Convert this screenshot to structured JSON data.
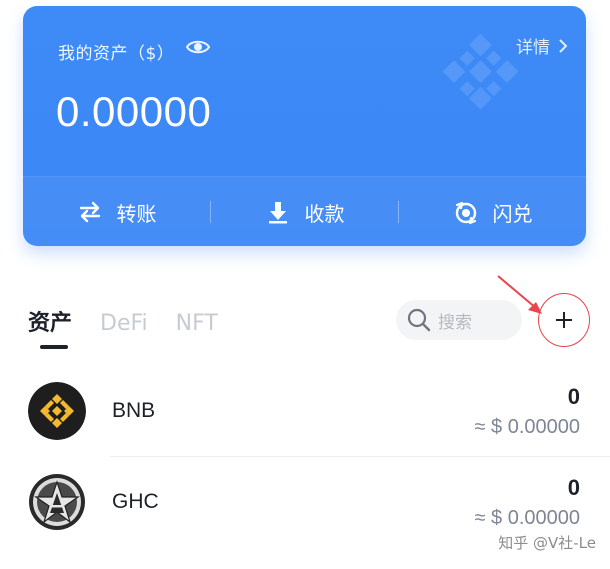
{
  "card": {
    "asset_label": "我的资产（$）",
    "details_label": "详情",
    "balance": "0.00000",
    "actions": [
      {
        "label": "转账",
        "icon": "transfer-icon"
      },
      {
        "label": "收款",
        "icon": "receive-icon"
      },
      {
        "label": "闪兑",
        "icon": "swap-icon"
      }
    ]
  },
  "tabs": [
    {
      "label": "资产",
      "active": true
    },
    {
      "label": "DeFi",
      "active": false
    },
    {
      "label": "NFT",
      "active": false
    }
  ],
  "search": {
    "placeholder": "搜索"
  },
  "tokens": [
    {
      "symbol": "BNB",
      "amount": "0",
      "fiat": "≈ $ 0.00000"
    },
    {
      "symbol": "GHC",
      "amount": "0",
      "fiat": "≈ $ 0.00000"
    }
  ],
  "watermark": "知乎 @V社-Le",
  "colors": {
    "card_blue": "#3a86f6",
    "bnb_yellow": "#f3ba2f",
    "annotation_red": "#e8454d"
  }
}
